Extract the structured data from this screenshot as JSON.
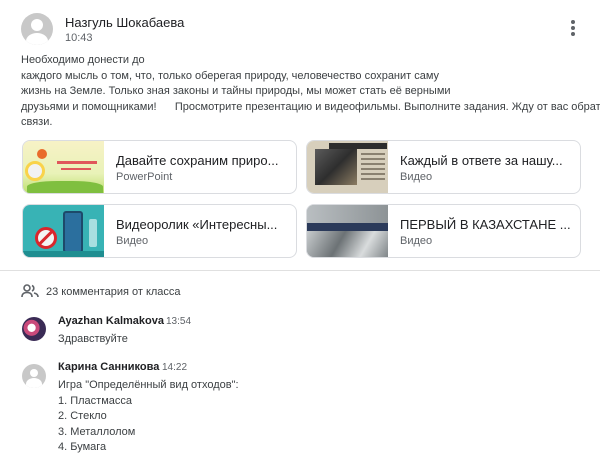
{
  "post": {
    "author": "Назгуль Шокабаева",
    "time": "10:43",
    "body_lines": [
      "Необходимо донести до",
      "каждого мысль о том, что, только оберегая природу, человечество сохранит саму",
      "жизнь на Земле. Только зная законы и тайны природы, мы может стать её верными",
      "друзьями и помощниками!      Просмотрите презентацию и видеофильмы. Выполните задания. Жду от вас обратной",
      "связи."
    ],
    "attachments": [
      {
        "title": "Давайте сохраним приро...",
        "type": "PowerPoint",
        "icon": "presentation-thumbnail"
      },
      {
        "title": "Каждый в ответе за нашу...",
        "type": "Видео",
        "icon": "newspaper-video-thumbnail"
      },
      {
        "title": "Видеоролик «Интересны...",
        "type": "Видео",
        "icon": "eco-video-thumbnail"
      },
      {
        "title": "ПЕРВЫЙ В КАЗАХСТАНЕ ...",
        "type": "Видео",
        "icon": "rubble-video-thumbnail"
      }
    ]
  },
  "comments_header": {
    "icon": "people-icon",
    "label": "23 комментария от класса"
  },
  "comments": [
    {
      "author": "Ayazhan Kalmakova",
      "time": "13:54",
      "lines": [
        "Здравствуйте"
      ]
    },
    {
      "author": "Карина Санникова",
      "time": "14:22",
      "lines": [
        "Игра \"Определённый вид отходов\":",
        "1. Пластмасса",
        "2. Стекло",
        "3. Металлолом",
        "4. Бумага"
      ]
    }
  ],
  "colors": {
    "text_primary": "#202124",
    "text_secondary": "#5f6368",
    "border": "#dadce0"
  }
}
